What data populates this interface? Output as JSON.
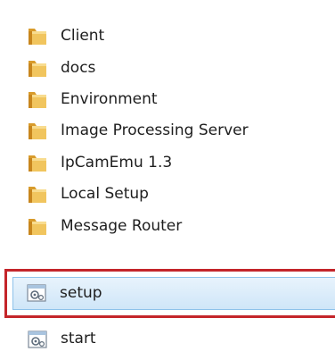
{
  "folders": [
    {
      "name": "Client",
      "icon": "folder-icon"
    },
    {
      "name": "docs",
      "icon": "folder-icon"
    },
    {
      "name": "Environment",
      "icon": "folder-icon"
    },
    {
      "name": "Image Processing Server",
      "icon": "folder-icon"
    },
    {
      "name": "IpCamEmu 1.3",
      "icon": "folder-icon"
    },
    {
      "name": "Local Setup",
      "icon": "folder-icon"
    },
    {
      "name": "Message Router",
      "icon": "folder-icon"
    }
  ],
  "files": [
    {
      "name": "setup",
      "icon": "settings-file-icon",
      "selected": true
    },
    {
      "name": "start",
      "icon": "settings-file-icon",
      "selected": false
    }
  ],
  "colors": {
    "folder": "#e9b84a",
    "selection_fill": "#d9ebfa",
    "selection_border": "#8ec2ea",
    "highlight_border": "#c4252a"
  }
}
